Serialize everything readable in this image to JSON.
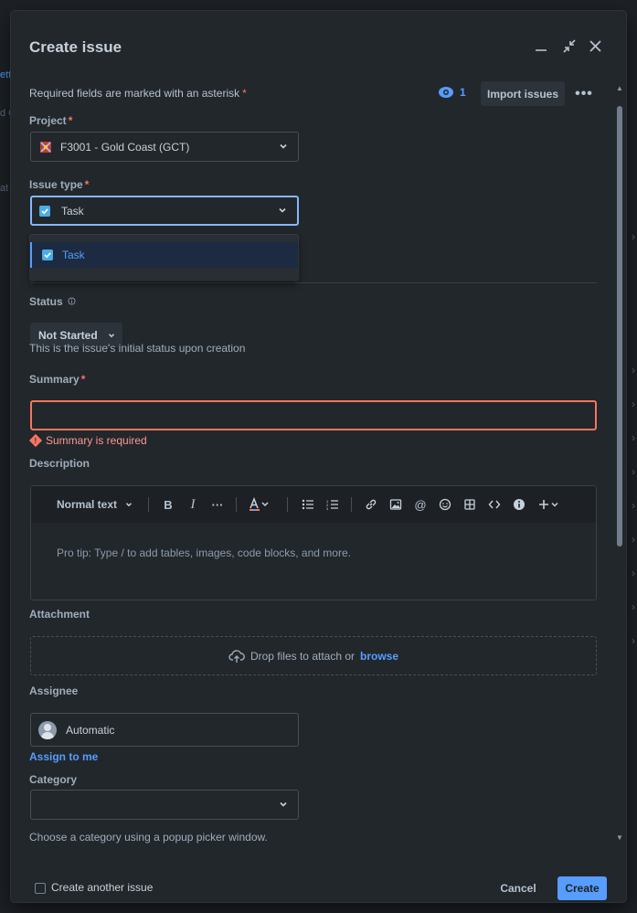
{
  "background": {
    "fragments": [
      "ett",
      "d C",
      "at"
    ]
  },
  "dialog": {
    "title": "Create issue",
    "required_note": "Required fields are marked with an asterisk",
    "asterisk": "*",
    "watch_count": "1",
    "import_label": "Import issues",
    "more_label": "•••"
  },
  "project": {
    "label": "Project",
    "value": "F3001 - Gold Coast (GCT)"
  },
  "issue_type": {
    "label": "Issue type",
    "value": "Task",
    "options": [
      "Task"
    ]
  },
  "status": {
    "label": "Status",
    "value": "Not Started",
    "helper": "This is the issue's initial status upon creation"
  },
  "summary": {
    "label": "Summary",
    "value": "",
    "error": "Summary is required"
  },
  "description": {
    "label": "Description",
    "text_style": "Normal text",
    "placeholder": "Pro tip: Type / to add tables, images, code blocks, and more."
  },
  "attachment": {
    "label": "Attachment",
    "drop_text": "Drop files to attach or",
    "browse": "browse"
  },
  "assignee": {
    "label": "Assignee",
    "value": "Automatic",
    "assign_to_me": "Assign to me"
  },
  "category": {
    "label": "Category",
    "value": "",
    "helper": "Choose a category using a popup picker window."
  },
  "footer": {
    "create_another": "Create another issue",
    "cancel": "Cancel",
    "create": "Create"
  },
  "colors": {
    "accent": "#579dff",
    "error": "#f87462",
    "surface": "#22272b"
  }
}
